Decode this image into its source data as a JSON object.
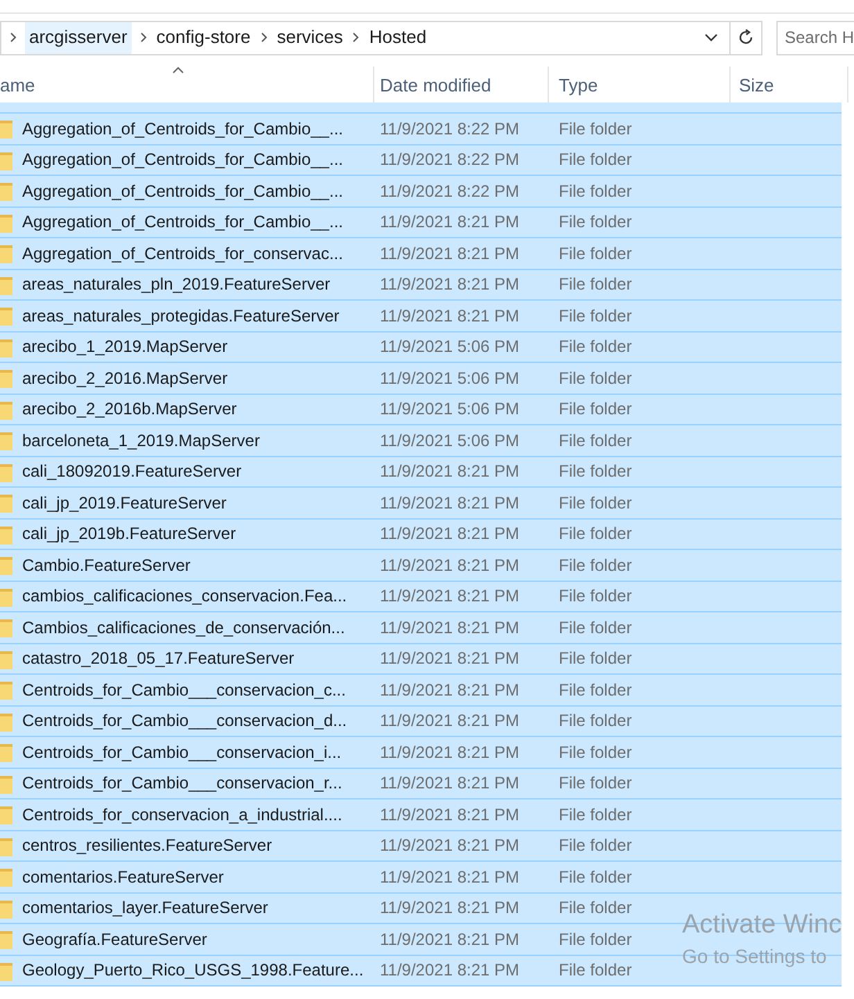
{
  "address_bar": {
    "crumbs": [
      {
        "label": "arcgisserver",
        "selected": true
      },
      {
        "label": "config-store",
        "selected": false
      },
      {
        "label": "services",
        "selected": false
      },
      {
        "label": "Hosted",
        "selected": false
      }
    ]
  },
  "search": {
    "placeholder": "Search H"
  },
  "columns": [
    {
      "label": "ame",
      "sorted": true
    },
    {
      "label": "Date modified",
      "sorted": false
    },
    {
      "label": "Type",
      "sorted": false
    },
    {
      "label": "Size",
      "sorted": false
    }
  ],
  "rows": [
    {
      "name": "Aggregation_of_Centroids_for_Cambio__...",
      "date": "11/9/2021 8:22 PM",
      "type": "File folder",
      "selected": true
    },
    {
      "name": "Aggregation_of_Centroids_for_Cambio__...",
      "date": "11/9/2021 8:22 PM",
      "type": "File folder",
      "selected": true
    },
    {
      "name": "Aggregation_of_Centroids_for_Cambio__...",
      "date": "11/9/2021 8:22 PM",
      "type": "File folder",
      "selected": true
    },
    {
      "name": "Aggregation_of_Centroids_for_Cambio__...",
      "date": "11/9/2021 8:21 PM",
      "type": "File folder",
      "selected": true
    },
    {
      "name": "Aggregation_of_Centroids_for_conservac...",
      "date": "11/9/2021 8:21 PM",
      "type": "File folder",
      "selected": true
    },
    {
      "name": "areas_naturales_pln_2019.FeatureServer",
      "date": "11/9/2021 8:21 PM",
      "type": "File folder",
      "selected": true
    },
    {
      "name": "areas_naturales_protegidas.FeatureServer",
      "date": "11/9/2021 8:21 PM",
      "type": "File folder",
      "selected": true
    },
    {
      "name": "arecibo_1_2019.MapServer",
      "date": "11/9/2021 5:06 PM",
      "type": "File folder",
      "selected": true
    },
    {
      "name": "arecibo_2_2016.MapServer",
      "date": "11/9/2021 5:06 PM",
      "type": "File folder",
      "selected": true
    },
    {
      "name": "arecibo_2_2016b.MapServer",
      "date": "11/9/2021 5:06 PM",
      "type": "File folder",
      "selected": true
    },
    {
      "name": "barceloneta_1_2019.MapServer",
      "date": "11/9/2021 5:06 PM",
      "type": "File folder",
      "selected": true
    },
    {
      "name": "cali_18092019.FeatureServer",
      "date": "11/9/2021 8:21 PM",
      "type": "File folder",
      "selected": true
    },
    {
      "name": "cali_jp_2019.FeatureServer",
      "date": "11/9/2021 8:21 PM",
      "type": "File folder",
      "selected": true
    },
    {
      "name": "cali_jp_2019b.FeatureServer",
      "date": "11/9/2021 8:21 PM",
      "type": "File folder",
      "selected": true
    },
    {
      "name": "Cambio.FeatureServer",
      "date": "11/9/2021 8:21 PM",
      "type": "File folder",
      "selected": true
    },
    {
      "name": "cambios_calificaciones_conservacion.Fea...",
      "date": "11/9/2021 8:21 PM",
      "type": "File folder",
      "selected": true
    },
    {
      "name": "Cambios_calificaciones_de_conservación...",
      "date": "11/9/2021 8:21 PM",
      "type": "File folder",
      "selected": true
    },
    {
      "name": "catastro_2018_05_17.FeatureServer",
      "date": "11/9/2021 8:21 PM",
      "type": "File folder",
      "selected": true
    },
    {
      "name": "Centroids_for_Cambio___conservacion_c...",
      "date": "11/9/2021 8:21 PM",
      "type": "File folder",
      "selected": true
    },
    {
      "name": "Centroids_for_Cambio___conservacion_d...",
      "date": "11/9/2021 8:21 PM",
      "type": "File folder",
      "selected": true
    },
    {
      "name": "Centroids_for_Cambio___conservacion_i...",
      "date": "11/9/2021 8:21 PM",
      "type": "File folder",
      "selected": true
    },
    {
      "name": "Centroids_for_Cambio___conservacion_r...",
      "date": "11/9/2021 8:21 PM",
      "type": "File folder",
      "selected": true
    },
    {
      "name": "Centroids_for_conservacion_a_industrial....",
      "date": "11/9/2021 8:21 PM",
      "type": "File folder",
      "selected": true
    },
    {
      "name": "centros_resilientes.FeatureServer",
      "date": "11/9/2021 8:21 PM",
      "type": "File folder",
      "selected": true
    },
    {
      "name": "comentarios.FeatureServer",
      "date": "11/9/2021 8:21 PM",
      "type": "File folder",
      "selected": true
    },
    {
      "name": "comentarios_layer.FeatureServer",
      "date": "11/9/2021 8:21 PM",
      "type": "File folder",
      "selected": true
    },
    {
      "name": "Geografía.FeatureServer",
      "date": "11/9/2021 8:21 PM",
      "type": "File folder",
      "selected": true
    },
    {
      "name": "Geology_Puerto_Rico_USGS_1998.Feature...",
      "date": "11/9/2021 8:21 PM",
      "type": "File folder",
      "selected": true
    }
  ],
  "activation_notice": [
    "Activate Winc",
    "Go to Settings to"
  ]
}
